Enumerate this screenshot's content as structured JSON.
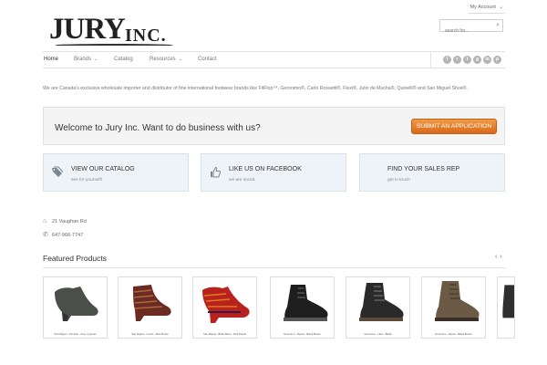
{
  "header": {
    "account_label": "My Account",
    "logo_word1": "JURY",
    "logo_word2": "INC.",
    "search_placeholder": "search for..."
  },
  "nav": {
    "items": [
      {
        "label": "Home",
        "active": true
      },
      {
        "label": "Brands",
        "dropdown": true
      },
      {
        "label": "Catalog"
      },
      {
        "label": "Resources",
        "dropdown": true
      },
      {
        "label": "Contact"
      }
    ],
    "social_icons": [
      "facebook-icon",
      "rss-icon",
      "twitter-icon",
      "googleplus-icon",
      "linkedin-icon",
      "pinterest-icon"
    ]
  },
  "intro": "We are Canada's exclusive wholesale importer and distributor of fine international footwear brands like FitFlop™, Geronimo®, Carlo Rossetti®, Flexi®, Julio de Mucha®, Quinelli® and San Miguel Shoe®.",
  "cta": {
    "text": "Welcome to Jury Inc. Want to do business with us?",
    "button": "SUBMIT AN APPLICATION",
    "button_color": "#e27a2a"
  },
  "features": [
    {
      "title": "VIEW OUR CATALOG",
      "subtitle": "see for yourself!",
      "icon": "tag-icon"
    },
    {
      "title": "LIKE US ON FACEBOOK",
      "subtitle": "we are social.",
      "icon": "thumbs-up-icon"
    },
    {
      "title": "FIND YOUR SALES REP",
      "subtitle": "get in touch",
      "icon": "map-icon"
    }
  ],
  "contact": {
    "address": "21 Vaughan Rd",
    "phone": "647-966-7747"
  },
  "featured": {
    "title": "Featured Products",
    "products": [
      {
        "label": "San Miguel - Ponchie - Grey Cypress",
        "color": "#4a4f4a"
      },
      {
        "label": "San Miguel - Lunch - Red Purple",
        "color": "#6b2a22"
      },
      {
        "label": "San Miguel - Bella Wave - Red Purple",
        "color": "#b8221c"
      },
      {
        "label": "Geronimo - Ryans - Black Brown",
        "color": "#1e1e1e"
      },
      {
        "label": "Geronimo - Lilou - Black",
        "color": "#2a2a2a"
      },
      {
        "label": "Geronimo - Ryans - Black Brown",
        "color": "#6b5a45"
      }
    ]
  }
}
